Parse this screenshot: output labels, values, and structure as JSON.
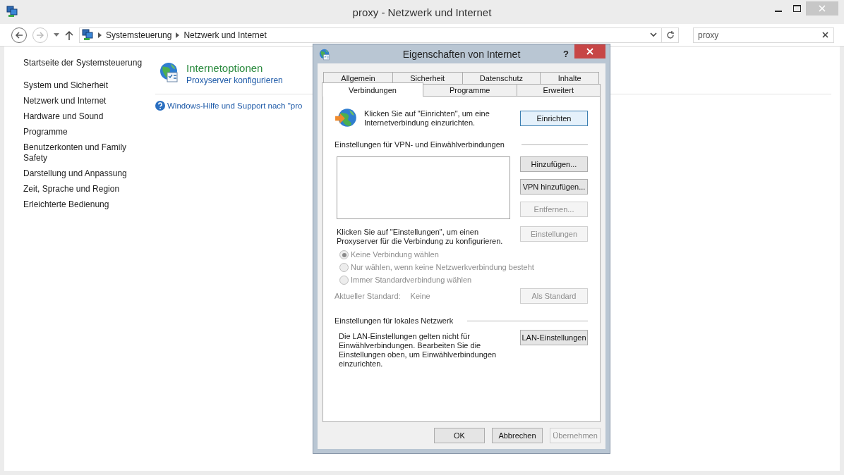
{
  "window": {
    "title": "proxy - Netzwerk und Internet"
  },
  "address_bar": {
    "breadcrumbs": [
      "Systemsteuerung",
      "Netzwerk und Internet"
    ]
  },
  "search": {
    "value": "proxy"
  },
  "sidebar": {
    "items": [
      {
        "label": "Startseite der Systemsteuerung"
      },
      {
        "label": "System und Sicherheit"
      },
      {
        "label": "Netzwerk und Internet"
      },
      {
        "label": "Hardware und Sound"
      },
      {
        "label": "Programme"
      },
      {
        "label": "Benutzerkonten und Family Safety"
      },
      {
        "label": "Darstellung und Anpassung"
      },
      {
        "label": "Zeit, Sprache und Region"
      },
      {
        "label": "Erleichterte Bedienung"
      }
    ]
  },
  "result": {
    "title": "Internetoptionen",
    "link": "Proxyserver konfigurieren",
    "help_link": "Windows-Hilfe und Support nach \"pro"
  },
  "dialog": {
    "title": "Eigenschaften von Internet",
    "help": "?",
    "tab_rows": [
      [
        {
          "label": "Allgemein",
          "selected": false
        },
        {
          "label": "Sicherheit",
          "selected": false
        },
        {
          "label": "Datenschutz",
          "selected": false
        },
        {
          "label": "Inhalte",
          "selected": false
        }
      ],
      [
        {
          "label": "Verbindungen",
          "selected": true
        },
        {
          "label": "Programme",
          "selected": false
        },
        {
          "label": "Erweitert",
          "selected": false
        }
      ]
    ],
    "setup": {
      "text": "Klicken Sie auf \"Einrichten\", um eine Internetverbindung einzurichten.",
      "button": {
        "label": "Einrichten",
        "disabled": false
      }
    },
    "vpn": {
      "heading": "Einstellungen für VPN- und Einwählverbindungen",
      "buttons": [
        {
          "label": "Hinzufügen...",
          "disabled": false
        },
        {
          "label": "VPN hinzufügen...",
          "disabled": false
        },
        {
          "label": "Entfernen...",
          "disabled": true
        }
      ]
    },
    "proxy": {
      "text": "Klicken Sie auf \"Einstellungen\", um einen Proxyserver für die Verbindung zu konfigurieren.",
      "button": {
        "label": "Einstellungen",
        "disabled": true
      }
    },
    "dial_options": {
      "disabled": true,
      "options": [
        {
          "label": "Keine Verbindung wählen",
          "selected": true
        },
        {
          "label": "Nur wählen, wenn keine Netzwerkverbindung besteht",
          "selected": false
        },
        {
          "label": "Immer Standardverbindung wählen",
          "selected": false
        }
      ]
    },
    "current_default": {
      "label": "Aktueller Standard:",
      "value": "Keine",
      "disabled": true,
      "button": {
        "label": "Als Standard",
        "disabled": true
      }
    },
    "lan": {
      "heading": "Einstellungen für lokales Netzwerk",
      "text": "Die LAN-Einstellungen gelten nicht für Einwählverbindungen. Bearbeiten Sie die Einstellungen oben, um Einwählverbindungen einzurichten.",
      "button": {
        "label": "LAN-Einstellungen",
        "disabled": false
      }
    },
    "footer_buttons": [
      {
        "label": "OK",
        "disabled": false
      },
      {
        "label": "Abbrechen",
        "disabled": false
      },
      {
        "label": "Übernehmen",
        "disabled": true
      }
    ]
  }
}
